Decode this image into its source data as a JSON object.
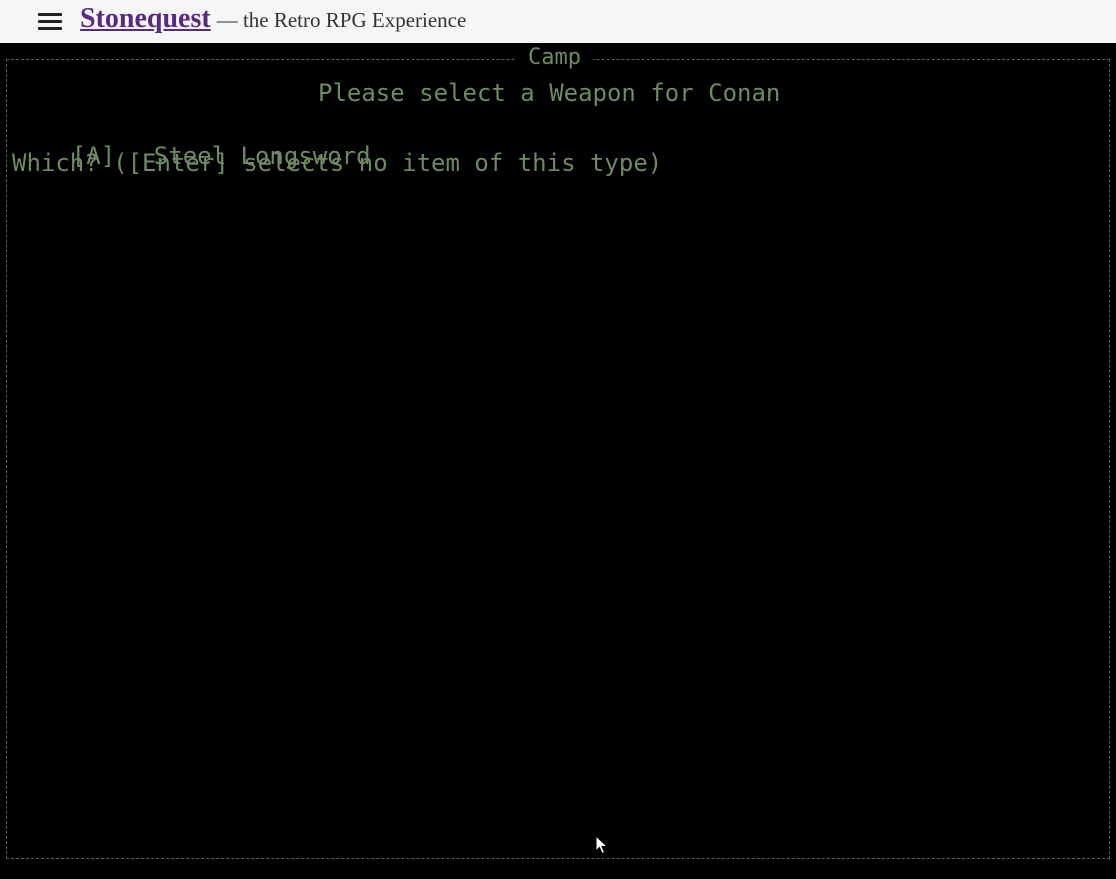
{
  "header": {
    "menu_icon": "hamburger-menu-icon",
    "brand": "Stonequest",
    "tagline": "— the Retro RPG Experience"
  },
  "terminal": {
    "frame_title": "Camp",
    "prompt_title": "Please select a Weapon for Conan",
    "items": [
      {
        "key": "[A]",
        "name": "Steel Longsword"
      }
    ],
    "question": "Which? ([Enter] selects no item of this type)",
    "text_color": "#6e8a62",
    "background": "#000000"
  },
  "colors": {
    "brand_link": "#5a2a80",
    "header_bg": "#f6f6f6"
  }
}
